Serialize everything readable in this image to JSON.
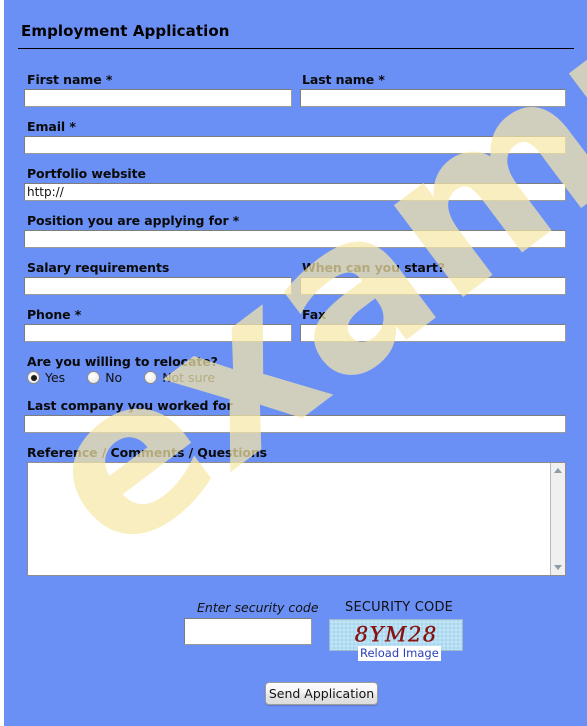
{
  "page": {
    "background_color": "#6b90f5",
    "title": "Employment Application"
  },
  "watermark": {
    "text": "example",
    "color": "#f7e7a8"
  },
  "fields": {
    "first_name": {
      "label": "First name *",
      "value": ""
    },
    "last_name": {
      "label": "Last name *",
      "value": ""
    },
    "email": {
      "label": "Email *",
      "value": ""
    },
    "portfolio": {
      "label": "Portfolio website",
      "value": "http://"
    },
    "position": {
      "label": "Position you are applying for *",
      "value": ""
    },
    "salary": {
      "label": "Salary requirements",
      "value": ""
    },
    "start_date": {
      "label": "When can you start?",
      "value": ""
    },
    "phone": {
      "label": "Phone *",
      "value": ""
    },
    "fax": {
      "label": "Fax",
      "value": ""
    },
    "last_company": {
      "label": "Last company you worked for",
      "value": ""
    },
    "comments": {
      "label": "Reference / Comments / Questions",
      "value": ""
    }
  },
  "relocate": {
    "label": "Are you willing to relocate?",
    "selected": "Yes",
    "options": [
      {
        "label": "Yes",
        "checked": true
      },
      {
        "label": "No",
        "checked": false
      },
      {
        "label": "Not sure",
        "checked": false
      }
    ]
  },
  "captcha": {
    "prompt": "Enter security code",
    "heading": "SECURITY CODE",
    "code": "8YM28",
    "code_color": "#8c1212",
    "image_background": "#b3ddf2",
    "reload_label": "Reload Image",
    "input_value": ""
  },
  "submit": {
    "label": "Send Application"
  }
}
